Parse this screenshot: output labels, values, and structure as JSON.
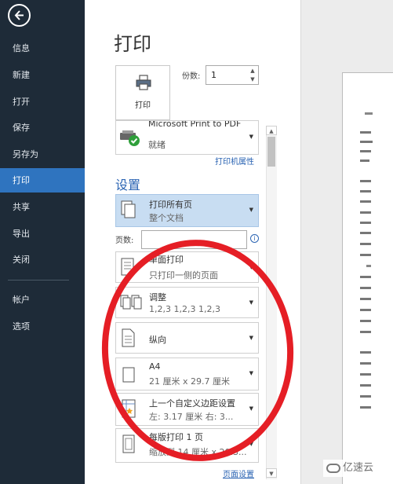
{
  "sidebar": {
    "items": [
      {
        "label": "信息"
      },
      {
        "label": "新建"
      },
      {
        "label": "打开"
      },
      {
        "label": "保存"
      },
      {
        "label": "另存为"
      },
      {
        "label": "打印"
      },
      {
        "label": "共享"
      },
      {
        "label": "导出"
      },
      {
        "label": "关闭"
      },
      {
        "label": "帐户"
      },
      {
        "label": "选项"
      }
    ],
    "active_item": "打印"
  },
  "page_title": "打印",
  "print_button": {
    "label": "打印"
  },
  "copies": {
    "label": "份数:",
    "value": "1"
  },
  "printer": {
    "name": "Microsoft Print to PDF",
    "status": "就绪",
    "properties_link": "打印机属性"
  },
  "settings": {
    "title": "设置",
    "options": [
      {
        "line1": "打印所有页",
        "line2": "整个文档"
      },
      {
        "line1": "单面打印",
        "line2": "只打印一侧的页面"
      },
      {
        "line1": "调整",
        "line2": "1,2,3    1,2,3    1,2,3"
      },
      {
        "line1": "纵向",
        "line2": ""
      },
      {
        "line1": "A4",
        "line2": "21 厘米 x 29.7 厘米"
      },
      {
        "line1": "上一个自定义边距设置",
        "line2": "左: 3.17 厘米    右: 3..."
      },
      {
        "line1": "每版打印 1 页",
        "line2": "缩放到 14 厘米 x 20.3..."
      }
    ],
    "pages_label": "页数:",
    "pages_value": ""
  },
  "page_setup_link": "页面设置",
  "watermark": "亿速云",
  "colors": {
    "sidebar_bg": "#1e2b38",
    "active_bg": "#2f74bf",
    "accent_blue": "#2b64b3",
    "annotation_red": "#e51e25"
  }
}
